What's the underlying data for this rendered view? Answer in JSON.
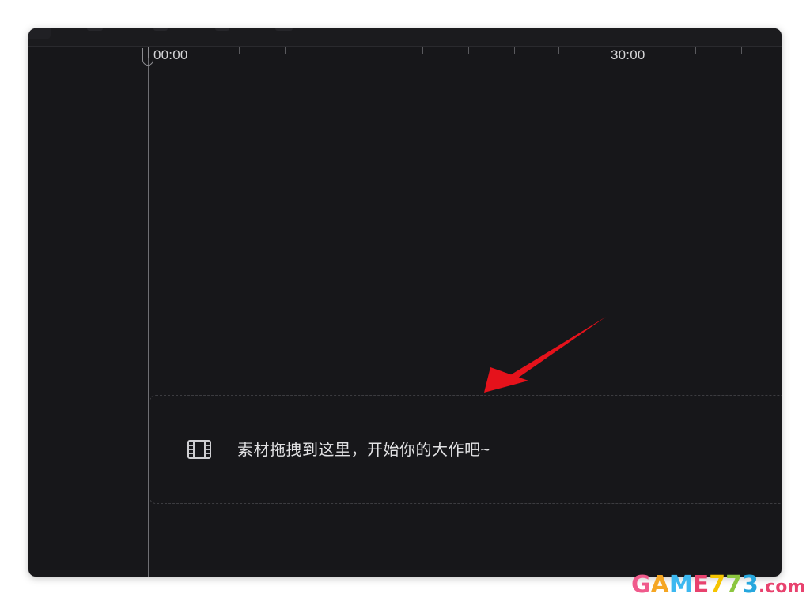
{
  "timeline": {
    "ruler": {
      "labels": [
        {
          "text": "00:00"
        },
        {
          "text": "30:00"
        }
      ]
    },
    "drop_zone": {
      "icon": "film-icon",
      "text": "素材拖拽到这里，开始你的大作吧~"
    }
  },
  "annotation": {
    "arrow_color": "#e5121b"
  },
  "watermark": {
    "segments": [
      {
        "text": "G",
        "color": "#f05a8c"
      },
      {
        "text": "A",
        "color": "#f5a623"
      },
      {
        "text": "M",
        "color": "#3cb8f0"
      },
      {
        "text": "E",
        "color": "#e8426e"
      },
      {
        "text": "7",
        "color": "#f5c400"
      },
      {
        "text": "7",
        "color": "#8cc63f"
      },
      {
        "text": "3",
        "color": "#26a7de"
      },
      {
        "text": ".com",
        "color": "#e8426e"
      }
    ]
  },
  "colors": {
    "window_bg": "#17171a",
    "text": "#e2e2e4",
    "tick": "#5a5a5e"
  }
}
